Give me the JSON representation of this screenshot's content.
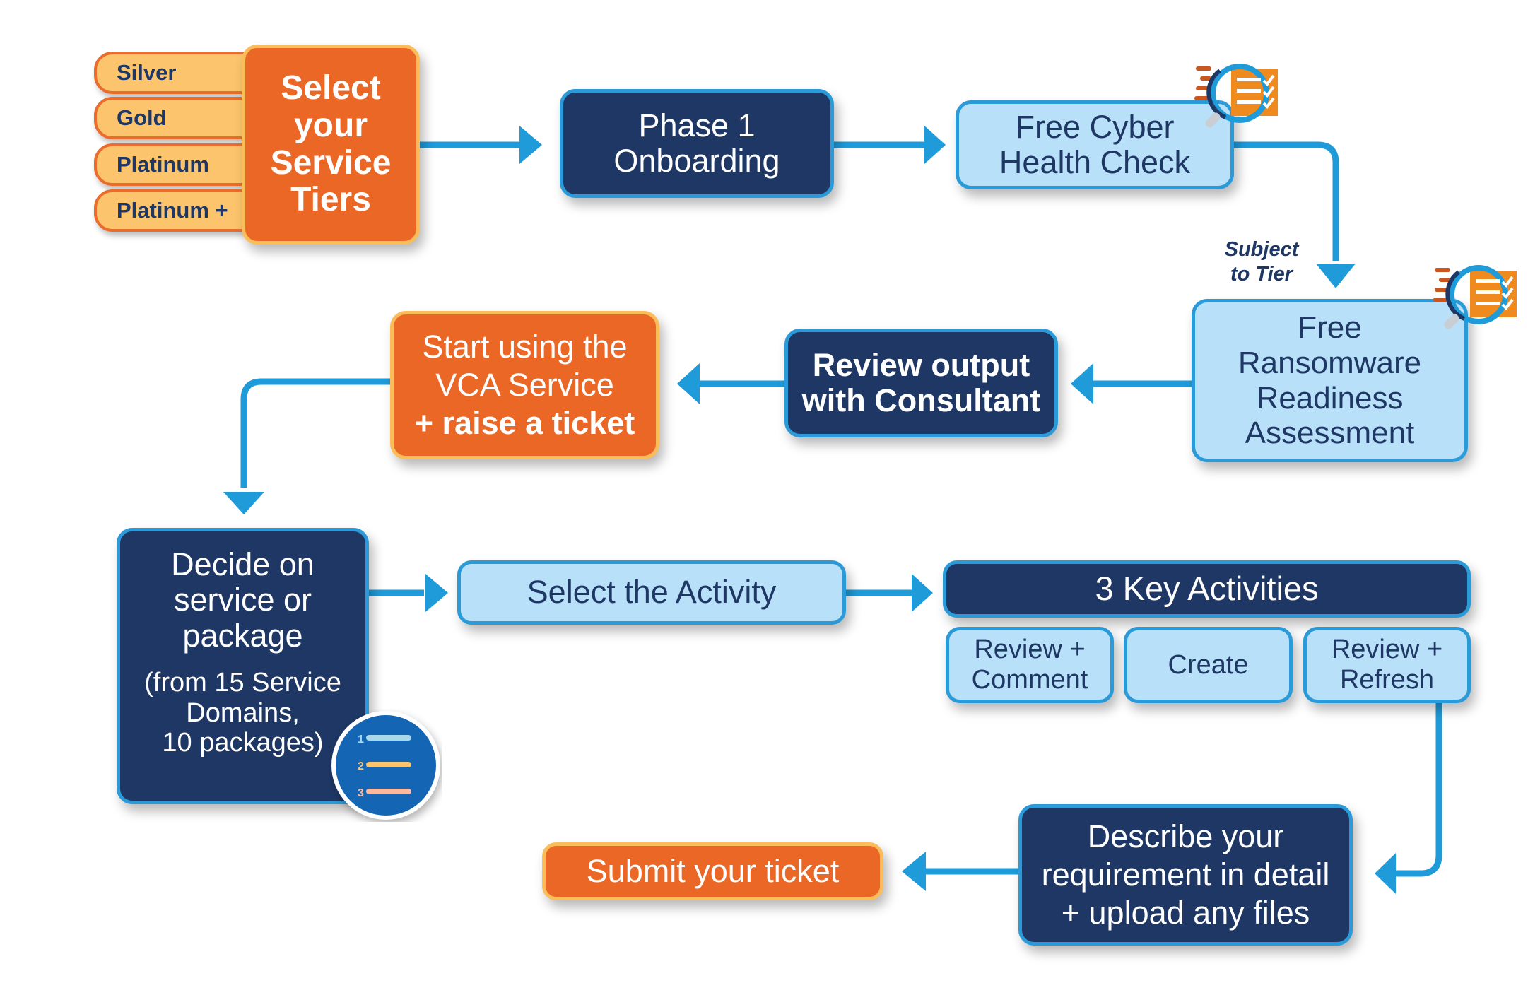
{
  "tiers": {
    "items": [
      "Silver",
      "Gold",
      "Platinum",
      "Platinum +"
    ],
    "title_lines": [
      "Select",
      "your",
      "Service",
      "Tiers"
    ]
  },
  "steps": {
    "phase1": [
      "Phase 1",
      "Onboarding"
    ],
    "cyber_check": [
      "Free Cyber",
      "Health Check"
    ],
    "subject_note": [
      "Subject",
      "to Tier"
    ],
    "ransomware": [
      "Free",
      "Ransomware",
      "Readiness",
      "Assessment"
    ],
    "review_output": [
      "Review output",
      "with Consultant"
    ],
    "start_using": [
      "Start using the",
      "VCA Service",
      "+ raise a ticket"
    ],
    "decide": [
      "Decide on",
      "service or",
      "package"
    ],
    "decide_detail": [
      "(from 15 Service",
      "Domains,",
      "10 packages)"
    ],
    "select_activity": "Select the Activity",
    "key_activities": {
      "title": "3 Key Activities",
      "items": [
        [
          "Review +",
          "Comment"
        ],
        [
          "Create"
        ],
        [
          "Review +",
          "Refresh"
        ]
      ]
    },
    "describe": [
      "Describe your",
      "requirement in detail",
      "+ upload any files"
    ],
    "submit": "Submit your ticket"
  },
  "list_icon": {
    "numbers": [
      "1",
      "2",
      "3"
    ]
  },
  "colors": {
    "navy": "#1e3764",
    "blue_accent": "#2a9ad8",
    "light_blue": "#b8e0f8",
    "orange": "#ea6726",
    "pale_orange": "#fcc46c"
  }
}
